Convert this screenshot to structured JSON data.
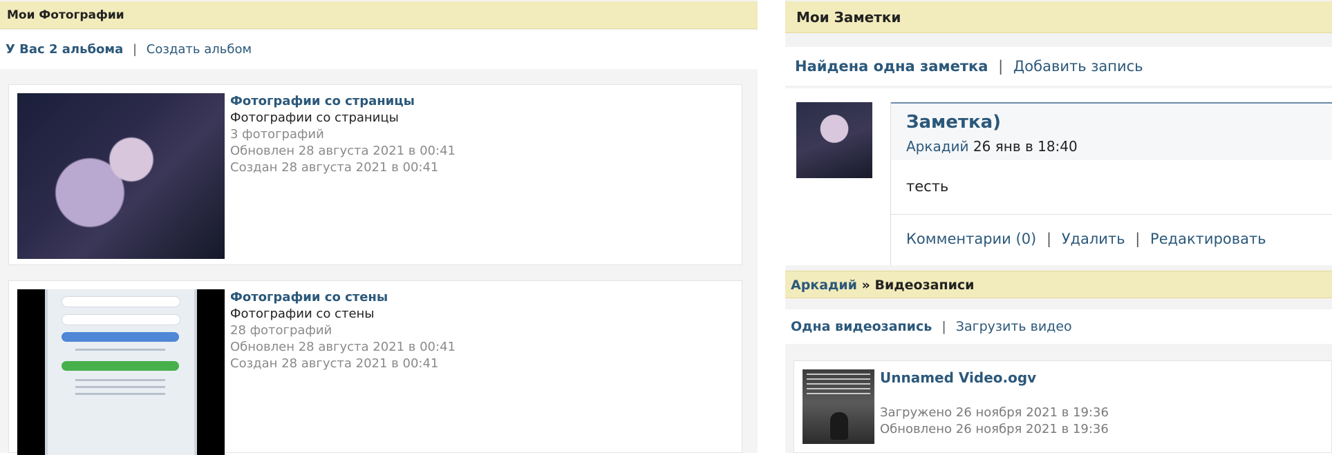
{
  "photos": {
    "header_title": "Мои Фотографии",
    "summary_count": "У Вас 2 альбома",
    "summary_separator": "|",
    "create_album_link": "Создать альбом",
    "albums": [
      {
        "title": "Фотографии со страницы",
        "subtitle": "Фотографии со страницы",
        "count": "3 фотографий",
        "updated": "Обновлен 28 августа 2021 в 00:41",
        "created": "Создан 28 августа 2021 в 00:41"
      },
      {
        "title": "Фотографии со стены",
        "subtitle": "Фотографии со стены",
        "count": "28 фотографий",
        "updated": "Обновлен 28 августа 2021 в 00:41",
        "created": "Создан 28 августа 2021 в 00:41"
      }
    ]
  },
  "notes": {
    "header_title": "Мои Заметки",
    "summary_count": "Найдена одна заметка",
    "summary_separator": "|",
    "add_link": "Добавить запись",
    "note": {
      "title": "Заметка)",
      "author": "Аркадий",
      "datetime": "26 янв в 18:40",
      "body": "тесть",
      "actions": {
        "comments": "Комментарии (0)",
        "delete": "Удалить",
        "edit": "Редактировать",
        "separator": "|"
      }
    }
  },
  "videos": {
    "header_user": "Аркадий",
    "header_arrow": "»",
    "header_section": "Видеозаписи",
    "summary_count": "Одна видеозапись",
    "summary_separator": "|",
    "upload_link": "Загрузить видео",
    "video": {
      "title": "Unnamed Video.ogv",
      "uploaded": "Загружено 26 ноября 2021 в 19:36",
      "updated": "Обновлено 26 ноября 2021 в 19:36"
    }
  },
  "colors": {
    "header_bg": "#f2ebbb",
    "link": "#2b587a",
    "muted_text": "#8a8a8a"
  }
}
